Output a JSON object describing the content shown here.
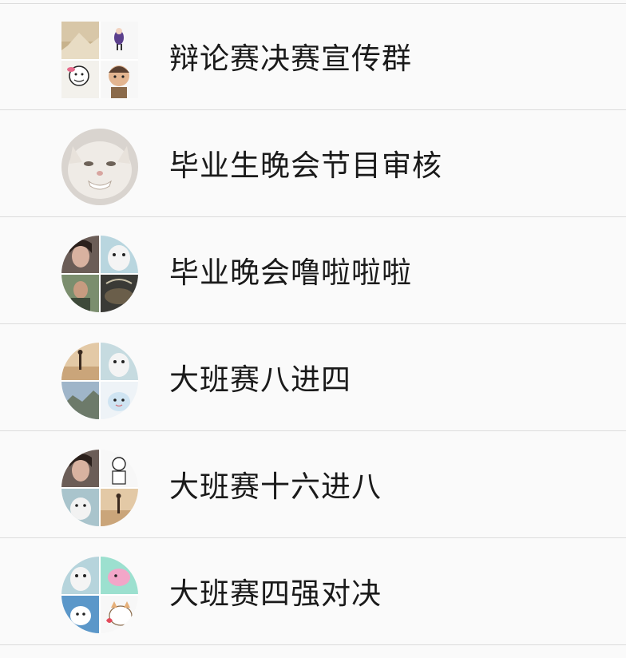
{
  "chat_list": {
    "groups": [
      {
        "name": "辩论赛决赛宣传群",
        "avatar_icon": "group-avatar-debate-icon"
      },
      {
        "name": "毕业生晚会节目审核",
        "avatar_icon": "cat-avatar-icon"
      },
      {
        "name": "毕业晚会噜啦啦啦",
        "avatar_icon": "group-avatar-party-icon"
      },
      {
        "name": "大班赛八进四",
        "avatar_icon": "group-avatar-match-icon"
      },
      {
        "name": "大班赛十六进八",
        "avatar_icon": "group-avatar-match-icon"
      },
      {
        "name": "大班赛四强对决",
        "avatar_icon": "group-avatar-match-icon"
      }
    ]
  },
  "colors": {
    "background": "#fafafa",
    "divider": "#dcdcdc",
    "text": "#1a1a1a"
  }
}
